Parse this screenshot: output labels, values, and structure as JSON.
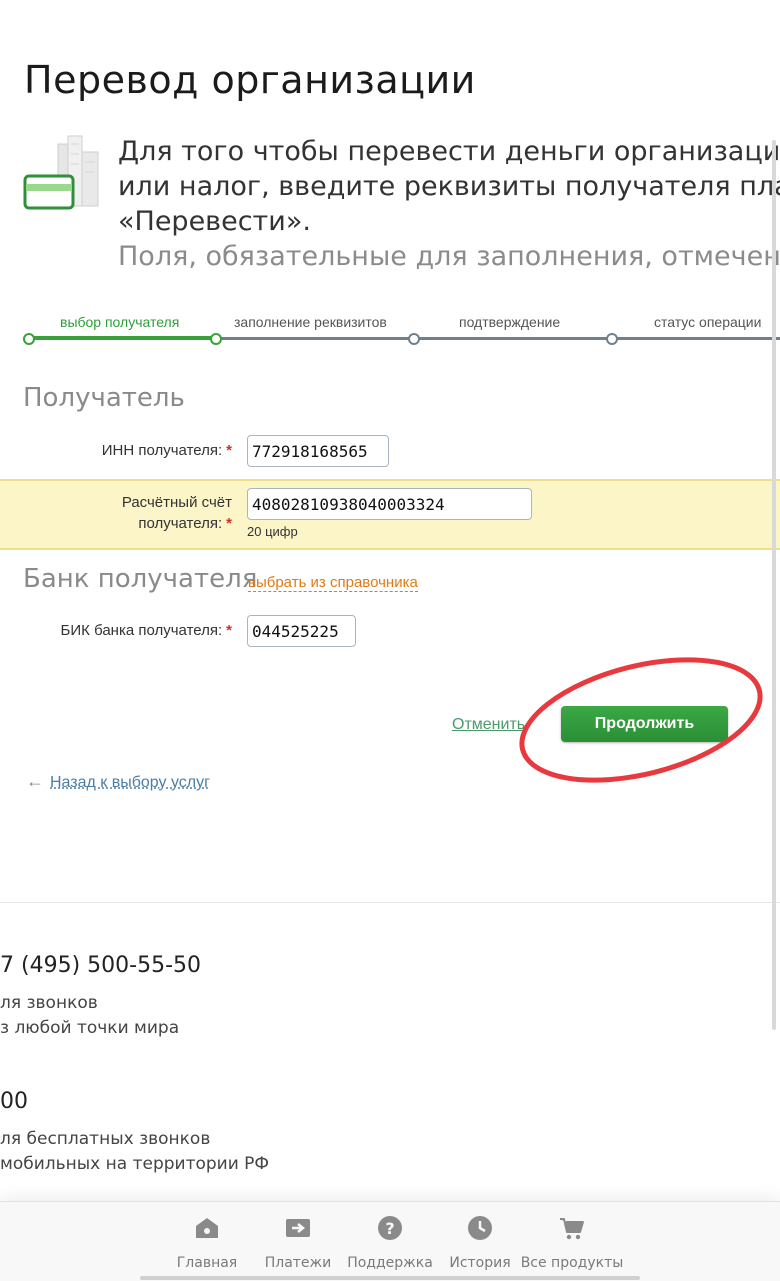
{
  "page": {
    "title": "Перевод организации"
  },
  "intro": {
    "line1": "Для того чтобы перевести деньги организации, о",
    "line2": "или налог, введите реквизиты получателя платеж",
    "line3": "«Перевести».",
    "hint": "Поля, обязательные для заполнения, отмечены ",
    "hint_star": "*"
  },
  "steps": [
    {
      "label": "выбор получателя",
      "active": true
    },
    {
      "label": "заполнение реквизитов",
      "active": false
    },
    {
      "label": "подтверждение",
      "active": false
    },
    {
      "label": "статус операции",
      "active": false
    }
  ],
  "recipient": {
    "section_title": "Получатель",
    "inn_label": "ИНН получателя:",
    "inn_value": "772918168565",
    "account_label_line1": "Расчётный счёт",
    "account_label_line2": "получателя:",
    "account_value": "40802810938040003324",
    "account_hint": "20 цифр",
    "required_mark": "*"
  },
  "bank": {
    "section_title": "Банк получателя",
    "directory_link": "выбрать из справочника",
    "bik_label": "БИК банка получателя:",
    "bik_value": "044525225"
  },
  "actions": {
    "cancel_label": "Отменить",
    "continue_label": "Продолжить",
    "back_arrow": "←",
    "back_label": "Назад к выбору услуг"
  },
  "contacts": [
    {
      "number": "7 (495) 500-55-50",
      "desc_line1": "ля звонков",
      "desc_line2": "з любой точки мира"
    },
    {
      "number": "00",
      "desc_line1": "ля бесплатных звонков",
      "desc_line2": "мобильных на территории РФ"
    }
  ],
  "bottom_nav": [
    {
      "label": "Главная",
      "icon": "home-icon"
    },
    {
      "label": "Платежи",
      "icon": "payments-icon"
    },
    {
      "label": "Поддержка",
      "icon": "support-icon"
    },
    {
      "label": "История",
      "icon": "history-icon"
    },
    {
      "label": "Все продукты",
      "icon": "cart-icon"
    }
  ],
  "colors": {
    "accent_green": "#3aa03a",
    "link_orange": "#e07b14",
    "highlight_yellow": "#fbf5c8",
    "annotation_red": "#e8393f"
  }
}
